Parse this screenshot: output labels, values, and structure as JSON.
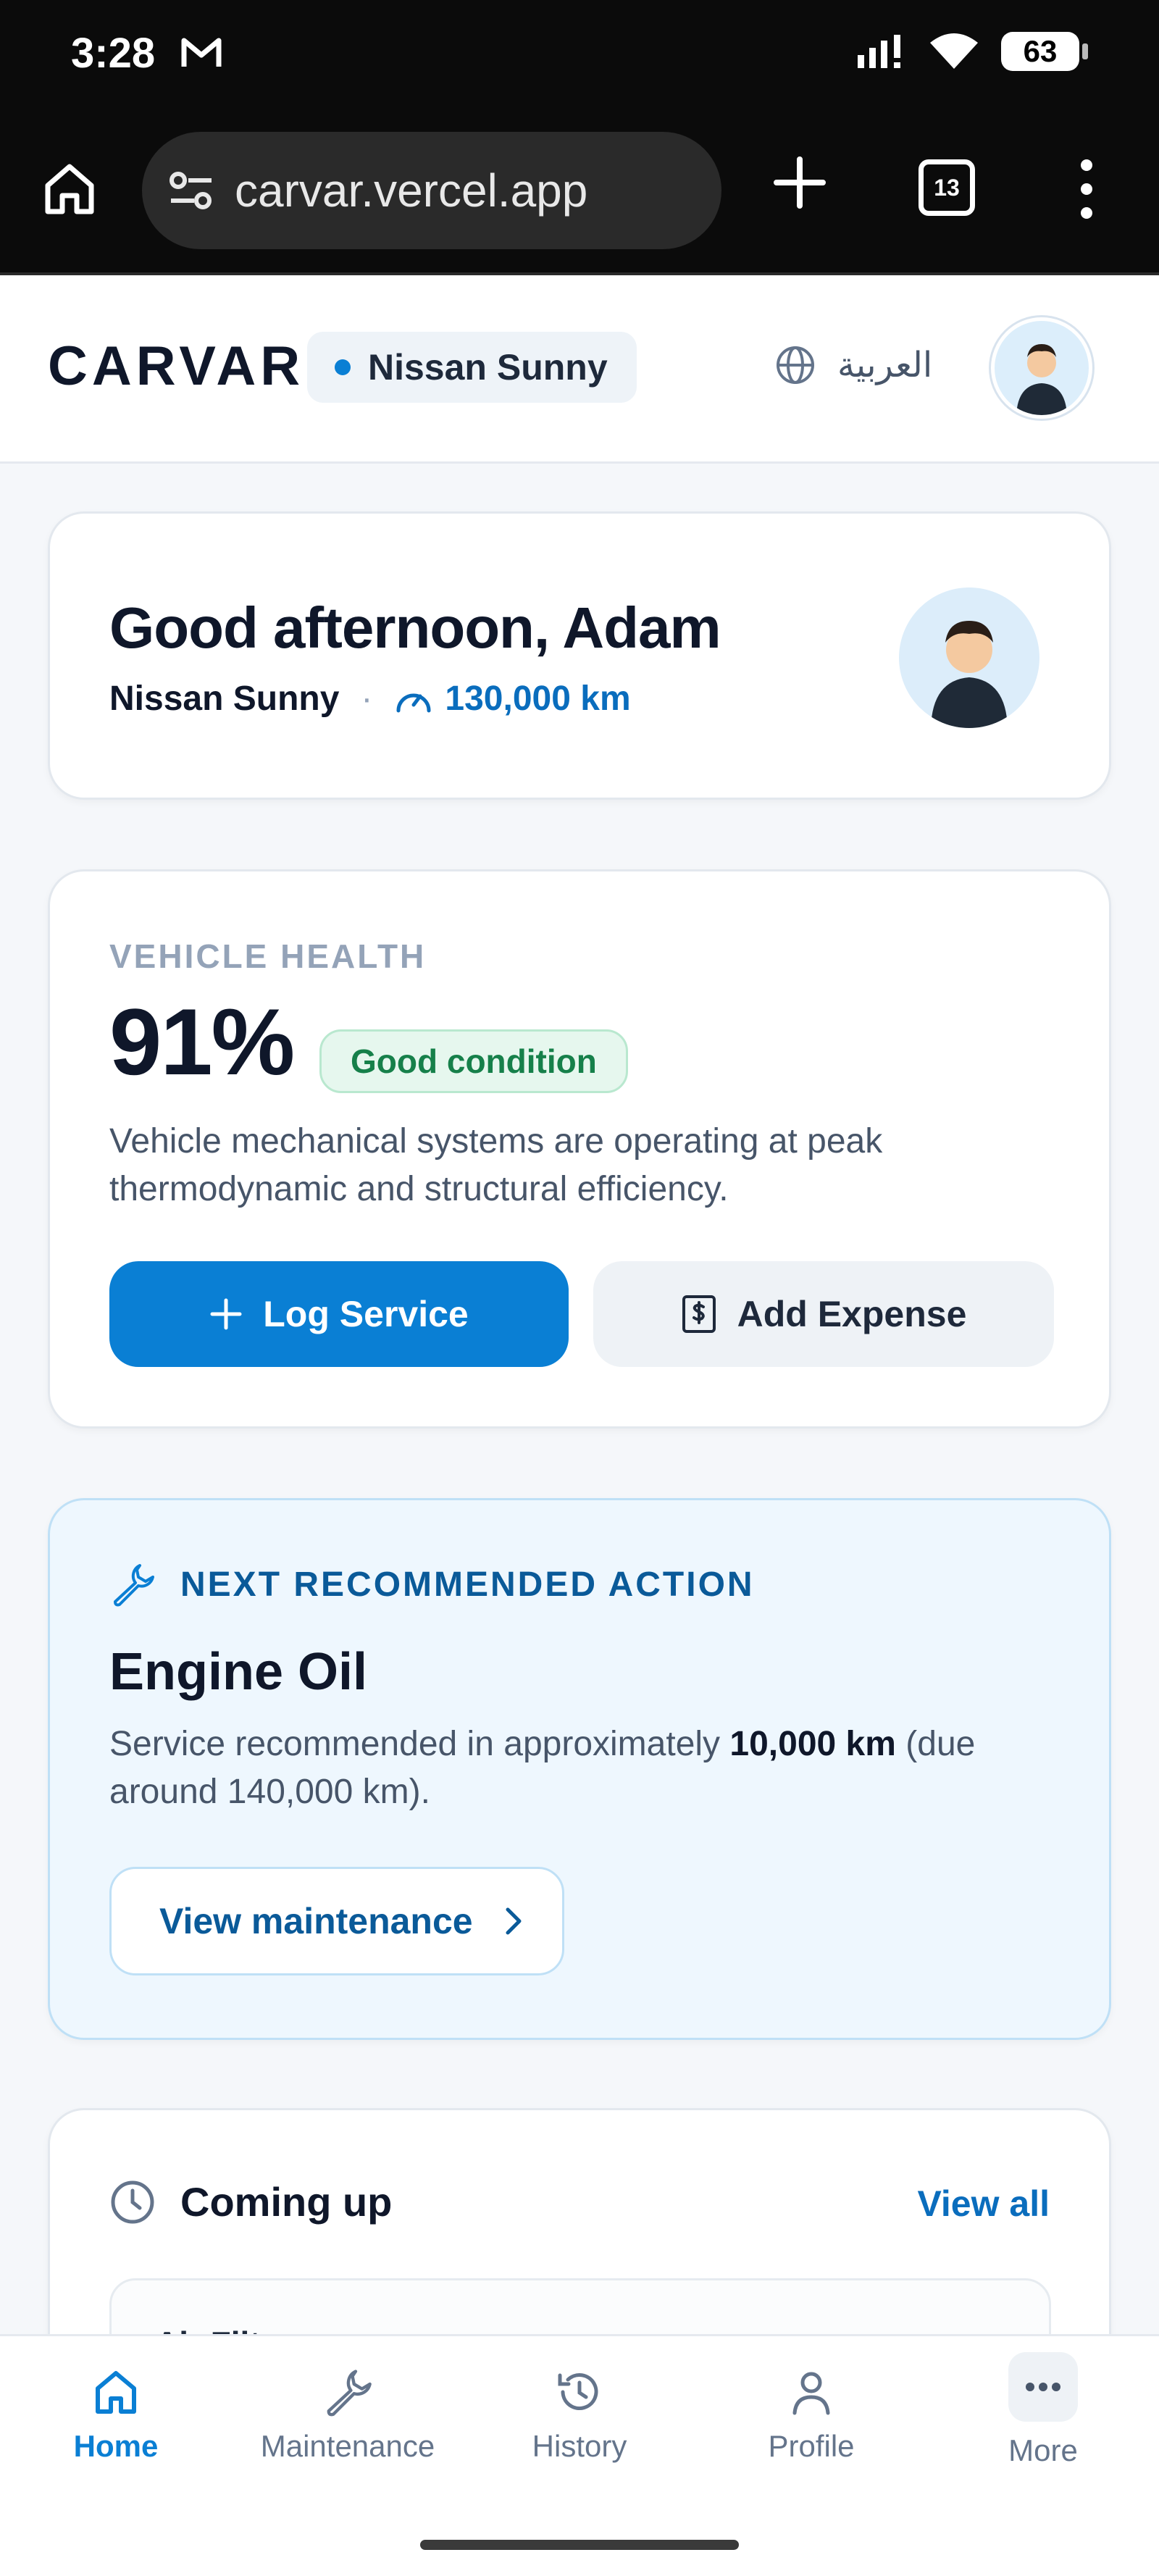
{
  "status_bar": {
    "time": "3:28",
    "battery": "63"
  },
  "browser": {
    "url": "carvar.vercel.app",
    "tab_count": "13"
  },
  "header": {
    "logo": "CARVAR",
    "vehicle": "Nissan Sunny",
    "language": "العربية"
  },
  "greeting": {
    "title": "Good afternoon, Adam",
    "vehicle": "Nissan Sunny",
    "separator": "·",
    "mileage": "130,000 km"
  },
  "health": {
    "label": "VEHICLE HEALTH",
    "percent": "91%",
    "badge": "Good condition",
    "description": "Vehicle mechanical systems are operating at peak thermodynamic and structural efficiency.",
    "log_service": "Log Service",
    "add_expense": "Add Expense"
  },
  "next_action": {
    "label": "NEXT RECOMMENDED ACTION",
    "title": "Engine Oil",
    "desc_pre": "Service recommended in approximately ",
    "desc_bold": "10,000 km",
    "desc_post": " (due around 140,000 km).",
    "button": "View maintenance"
  },
  "upcoming": {
    "title": "Coming up",
    "view_all": "View all",
    "first_item": "Air Filter"
  },
  "bottom_nav": [
    {
      "label": "Home",
      "icon": "home-icon"
    },
    {
      "label": "Maintenance",
      "icon": "wrench-icon"
    },
    {
      "label": "History",
      "icon": "history-icon"
    },
    {
      "label": "Profile",
      "icon": "person-icon"
    },
    {
      "label": "More",
      "icon": "more-icon"
    }
  ],
  "colors": {
    "primary": "#0a7fd4",
    "success": "#16804a",
    "action_bg": "#eef7fe"
  }
}
